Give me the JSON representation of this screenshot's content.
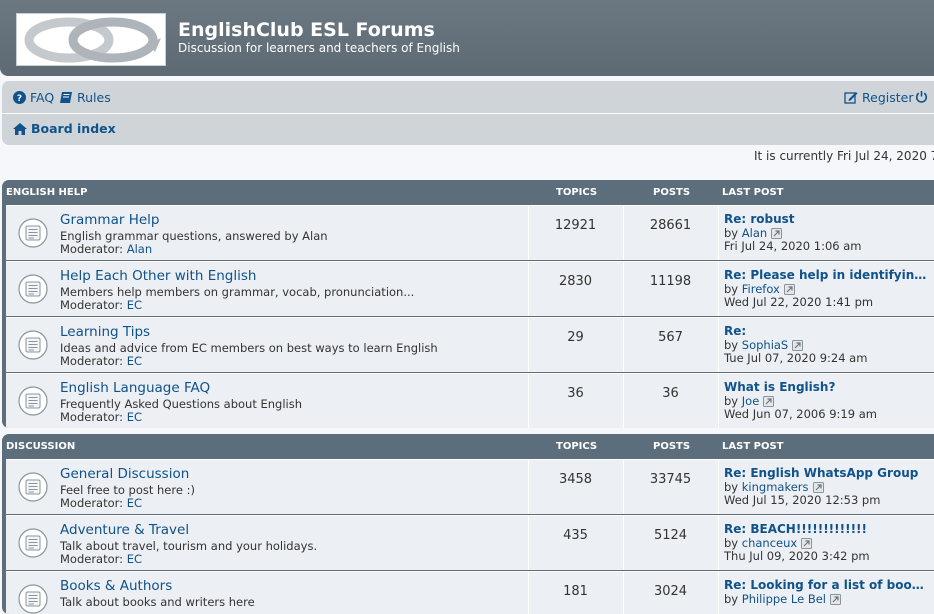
{
  "header": {
    "title": "EnglishClub ESL Forums",
    "description": "Discussion for learners and teachers of English"
  },
  "nav": {
    "faq": "FAQ",
    "rules": "Rules",
    "register": "Register",
    "board_index": "Board index"
  },
  "current_time": "It is currently Fri Jul 24, 2020 7:",
  "moderator_label": "Moderator:",
  "by_label": "by",
  "colors": {
    "link": "#105289",
    "header": "#5e6a73",
    "row": "#eceff3"
  },
  "categories": [
    {
      "name": "ENGLISH HELP",
      "col_topics": "TOPICS",
      "col_posts": "POSTS",
      "col_last": "LAST POST",
      "forums": [
        {
          "title": "Grammar Help",
          "desc": "English grammar questions, answered by Alan",
          "moderator": "Alan",
          "topics": "12921",
          "posts": "28661",
          "last_title": "Re: robust",
          "last_by": "Alan",
          "last_time": "Fri Jul 24, 2020 1:06 am"
        },
        {
          "title": "Help Each Other with English",
          "desc": "Members help members on grammar, vocab, pronunciation...",
          "moderator": "EC",
          "topics": "2830",
          "posts": "11198",
          "last_title": "Re: Please help in identifyin…",
          "last_by": "Firefox",
          "last_time": "Wed Jul 22, 2020 1:41 pm"
        },
        {
          "title": "Learning Tips",
          "desc": "Ideas and advice from EC members on best ways to learn English",
          "moderator": "EC",
          "topics": "29",
          "posts": "567",
          "last_title": "Re:",
          "last_by": "SophiaS",
          "last_time": "Tue Jul 07, 2020 9:24 am"
        },
        {
          "title": "English Language FAQ",
          "desc": "Frequently Asked Questions about English",
          "moderator": "EC",
          "topics": "36",
          "posts": "36",
          "last_title": "What is English?",
          "last_by": "Joe",
          "last_time": "Wed Jun 07, 2006 9:19 am"
        }
      ]
    },
    {
      "name": "DISCUSSION",
      "col_topics": "TOPICS",
      "col_posts": "POSTS",
      "col_last": "LAST POST",
      "forums": [
        {
          "title": "General Discussion",
          "desc": "Feel free to post here :)",
          "moderator": "EC",
          "topics": "3458",
          "posts": "33745",
          "last_title": "Re: English WhatsApp Group",
          "last_by": "kingmakers",
          "last_time": "Wed Jul 15, 2020 12:53 pm"
        },
        {
          "title": "Adventure & Travel",
          "desc": "Talk about travel, tourism and your holidays.",
          "moderator": "EC",
          "topics": "435",
          "posts": "5124",
          "last_title": "Re: BEACH!!!!!!!!!!!!!",
          "last_by": "chanceux",
          "last_time": "Thu Jul 09, 2020 3:42 pm"
        },
        {
          "title": "Books & Authors",
          "desc": "Talk about books and writers here",
          "moderator": "",
          "topics": "181",
          "posts": "3024",
          "last_title": "Re: Looking for a list of boo…",
          "last_by": "Philippe Le Bel",
          "last_time": ""
        }
      ]
    }
  ]
}
